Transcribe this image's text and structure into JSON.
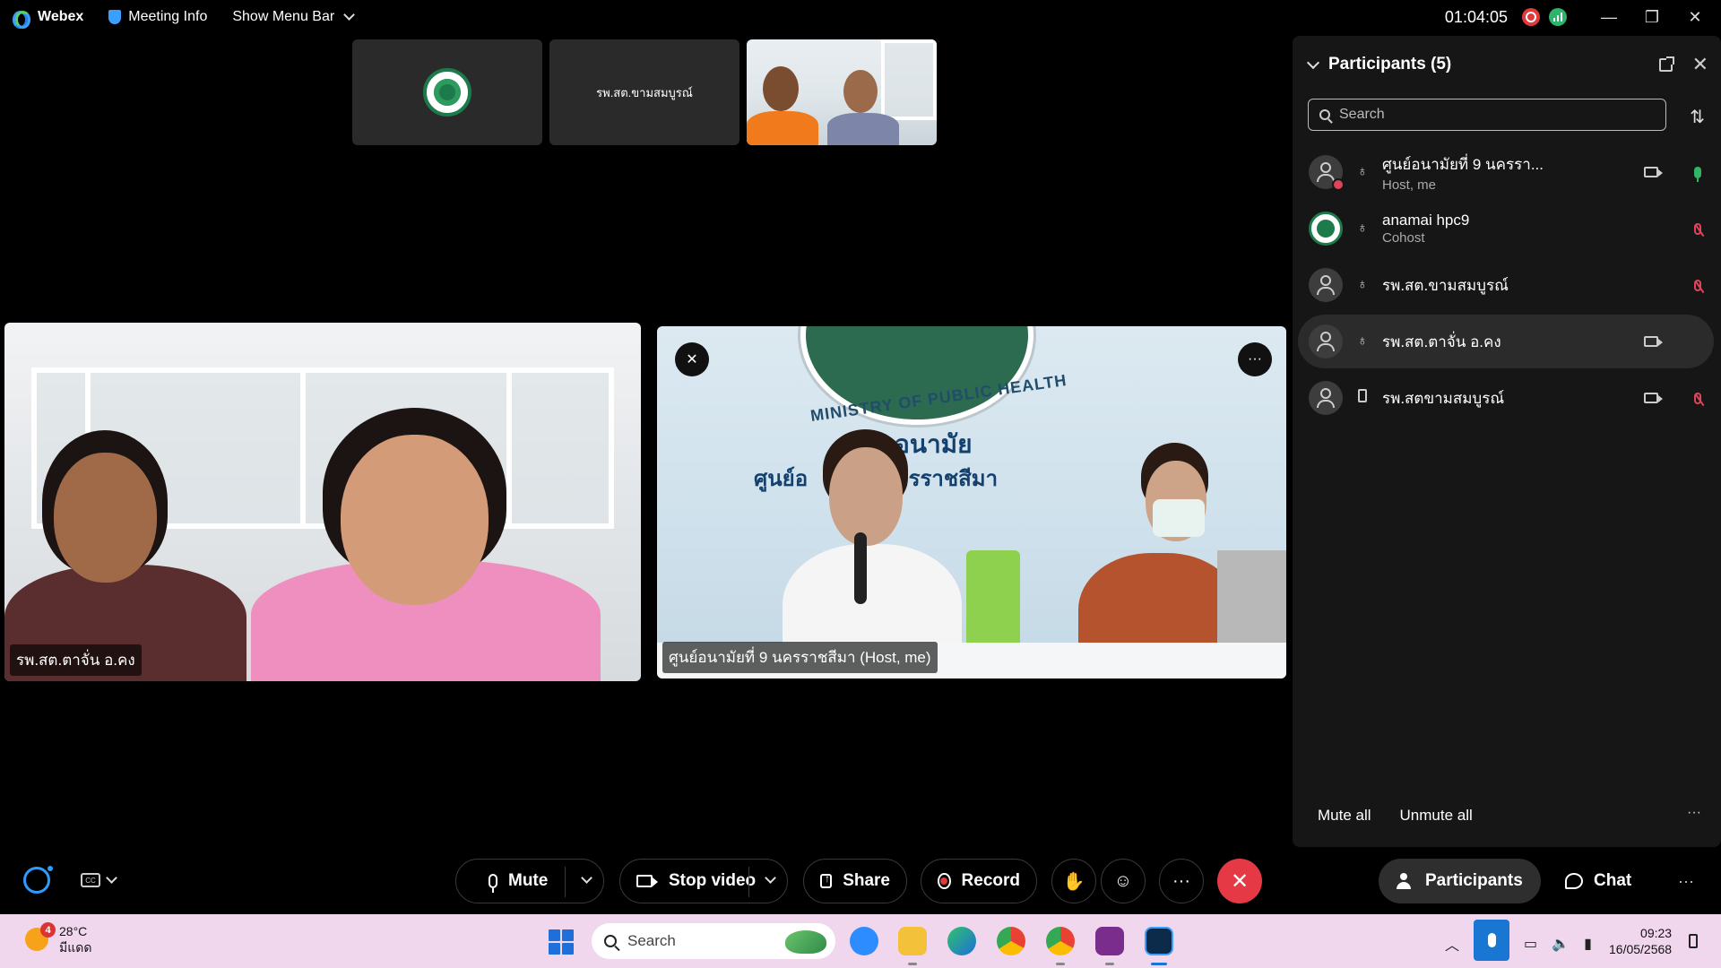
{
  "app": {
    "name": "Webex",
    "meeting_info": "Meeting Info",
    "show_menu_bar": "Show Menu Bar",
    "timer": "01:04:05",
    "window_controls": [
      "minimize-icon",
      "restore-icon",
      "close-icon"
    ]
  },
  "thumbnails": [
    {
      "type": "logo",
      "label": ""
    },
    {
      "type": "name",
      "label": "รพ.สต.ขามสมบูรณ์"
    },
    {
      "type": "video",
      "label": ""
    }
  ],
  "tiles": {
    "left": {
      "name_label": "รพ.สต.ตาจั่น อ.คง"
    },
    "right": {
      "name_label": "ศูนย์อนามัยที่ 9 นครราชสีมา (Host, me)",
      "seal_text": "MINISTRY OF PUBLIC HEALTH",
      "banner_line1": "อนามัย",
      "banner_line2": "ศูนย์อ        9  นครราชสีมา",
      "pin_icon": "pin-icon",
      "more_icon": "more-icon"
    }
  },
  "participants": {
    "title": "Participants (5)",
    "search_placeholder": "Search",
    "list": [
      {
        "name": "ศูนย์อนามัยที่ 9 นครรา...",
        "role": "Host, me",
        "avatar": "person",
        "connection": "headset",
        "video": true,
        "mic": "on"
      },
      {
        "name": "anamai hpc9",
        "role": "Cohost",
        "avatar": "logo",
        "connection": "headset",
        "video": false,
        "mic": "muted"
      },
      {
        "name": "รพ.สต.ขามสมบูรณ์",
        "role": "",
        "avatar": "person",
        "connection": "headset",
        "video": false,
        "mic": "muted"
      },
      {
        "name": "รพ.สต.ตาจั่น อ.คง",
        "role": "",
        "avatar": "person",
        "connection": "headset",
        "video": true,
        "mic": "none"
      },
      {
        "name": "รพ.สตขามสมบูรณ์",
        "role": "",
        "avatar": "person",
        "connection": "phone",
        "video": true,
        "mic": "muted"
      }
    ],
    "mute_all": "Mute all",
    "unmute_all": "Unmute all",
    "more": "···"
  },
  "toolbar": {
    "mute": "Mute",
    "stop_video": "Stop video",
    "share": "Share",
    "record": "Record",
    "more": "···",
    "participants": "Participants",
    "chat": "Chat"
  },
  "taskbar": {
    "weather_temp": "28°C",
    "weather_desc": "มีแดด",
    "weather_badge": "4",
    "search_placeholder": "Search",
    "time": "09:23",
    "date": "16/05/2568"
  },
  "colors": {
    "accent_blue": "#2d9cff",
    "end_red": "#e53946",
    "mic_on_green": "#31b463",
    "muted_red": "#e0445a",
    "taskbar_bg": "#f1d7ee"
  }
}
